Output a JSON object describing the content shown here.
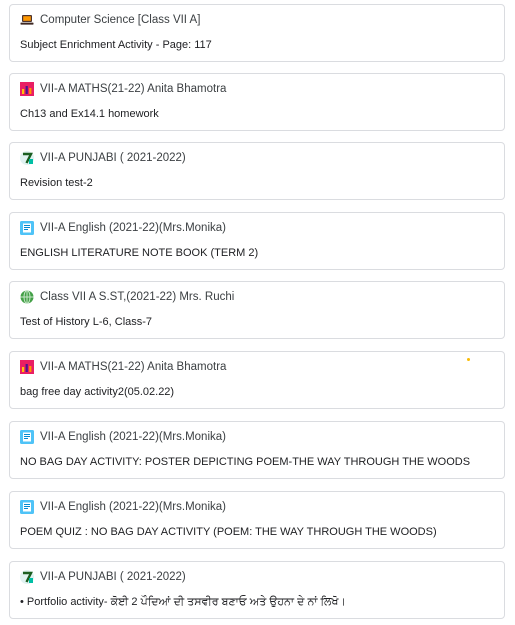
{
  "stream": {
    "cards": [
      {
        "class_name": "Computer Science [Class VII A]",
        "title": "Subject Enrichment Activity - Page: 117",
        "icon": "laptop-icon"
      },
      {
        "class_name": "VII-A MATHS(21-22) Anita Bhamotra",
        "title": "Ch13 and Ex14.1 homework",
        "icon": "bar-chart-icon"
      },
      {
        "class_name": "VII-A PUNJABI ( 2021-2022)",
        "title": "Revision test-2",
        "icon": "seven-icon"
      },
      {
        "class_name": "VII-A English (2021-22)(Mrs.Monika)",
        "title": "ENGLISH LITERATURE NOTE BOOK (TERM 2)",
        "icon": "notebook-icon"
      },
      {
        "class_name": "Class VII A S.ST,(2021-22) Mrs. Ruchi",
        "title": "Test of History L-6, Class-7",
        "icon": "globe-icon"
      },
      {
        "class_name": "VII-A MATHS(21-22) Anita Bhamotra",
        "title": "bag free day activity2(05.02.22)",
        "icon": "bar-chart-icon"
      },
      {
        "class_name": "VII-A English (2021-22)(Mrs.Monika)",
        "title": "NO BAG DAY ACTIVITY: POSTER DEPICTING POEM-THE WAY THROUGH THE WOODS",
        "icon": "notebook-icon"
      },
      {
        "class_name": "VII-A English (2021-22)(Mrs.Monika)",
        "title": "POEM QUIZ : NO BAG DAY ACTIVITY (POEM: THE WAY THROUGH THE WOODS)",
        "icon": "notebook-icon"
      },
      {
        "class_name": "VII-A PUNJABI ( 2021-2022)",
        "title": "• Portfolio activity- ਕੋਈ 2 ਪੌਦਿਆਂ ਦੀ ਤਸਵੀਰ ਬਣਾਓ ਅਤੇ ਉਹਨਾ ਦੇ ਨਾਂ ਲਿਖੋ।",
        "icon": "seven-icon"
      }
    ]
  },
  "colors": {
    "border": "#dadce0",
    "text": "#202124",
    "accent_dot": "#fbbc04"
  }
}
